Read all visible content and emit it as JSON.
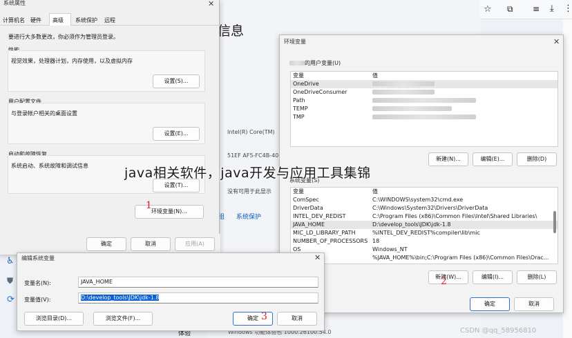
{
  "browser": {
    "tab_text": "",
    "icons": [
      "star-icon",
      "extensions-icon",
      "reading-list-icon",
      "download-icon",
      "more-icon"
    ]
  },
  "background_settings": {
    "heading": "信息",
    "spec_rows": [
      "Intel(R) Core(TM)",
      "51EF AF5-FC4B-40",
      "没有可用于此显示"
    ],
    "links": [
      "组",
      "系统保护"
    ],
    "bottom_label": "体验",
    "bottom_value": "Windows 功能体验包 1000.26100.54.0",
    "side_icons": [
      "accessibility-icon",
      "shield-icon",
      "update-icon"
    ]
  },
  "system_properties": {
    "title": "系统属性",
    "tabs": [
      "计算机名",
      "硬件",
      "高级",
      "系统保护",
      "远程"
    ],
    "active_tab": 2,
    "admin_note": "要进行大多数更改，你必须作为管理员登录。",
    "performance": {
      "title": "性能",
      "desc": "视觉效果，处理器计划，内存使用，以及虚拟内存",
      "button": "设置(S)..."
    },
    "user_profiles": {
      "title": "用户配置文件",
      "desc": "与登录帐户相关的桌面设置",
      "button": "设置(E)..."
    },
    "startup_recovery": {
      "title": "启动和故障恢复",
      "desc": "系统启动、系统故障和调试信息",
      "button": "设置(T)..."
    },
    "env_button": "环境变量(N)...",
    "ok": "确定",
    "cancel": "取消",
    "apply": "应用(A)"
  },
  "env_vars": {
    "title": "环境变量",
    "user_section": "的用户变量(U)",
    "col_var": "变量",
    "col_value": "值",
    "user_vars": [
      {
        "name": "OneDrive",
        "value": "C:\\Users\\...\\OneDrive"
      },
      {
        "name": "OneDriveConsumer",
        "value": "C:\\Users\\...\\OneDrive"
      },
      {
        "name": "Path",
        "value": ""
      },
      {
        "name": "TEMP",
        "value": ""
      },
      {
        "name": "TMP",
        "value": ""
      }
    ],
    "user_buttons": [
      "新建(N)...",
      "编辑(E)...",
      "删除(D)"
    ],
    "system_section": "系统变量(S)",
    "system_vars": [
      {
        "name": "ComSpec",
        "value": "C:\\WINDOWS\\system32\\cmd.exe"
      },
      {
        "name": "DriverData",
        "value": "C:\\Windows\\System32\\Drivers\\DriverData"
      },
      {
        "name": "INTEL_DEV_REDIST",
        "value": "C:\\Program Files (x86)\\Common Files\\Intel\\Shared Libraries\\"
      },
      {
        "name": "JAVA_HOME",
        "value": "D:\\develop_tools\\JDK\\jdk-1.8"
      },
      {
        "name": "MIC_LD_LIBRARY_PATH",
        "value": "%INTEL_DEV_REDIST%compiler\\lib\\mic"
      },
      {
        "name": "NUMBER_OF_PROCESSORS",
        "value": "18"
      },
      {
        "name": "OS",
        "value": "Windows_NT"
      },
      {
        "name": "Path",
        "value": "%JAVA_HOME%\\bin;C:\\Program Files (x86)\\Common Files\\Orac..."
      }
    ],
    "system_buttons": [
      "新建(W)...",
      "编辑(I)...",
      "删除(L)"
    ],
    "ok": "确定",
    "cancel": "取消"
  },
  "edit_dialog": {
    "title": "编辑系统变量",
    "name_label": "变量名(N):",
    "name_value": "JAVA_HOME",
    "value_label": "变量值(V):",
    "value_value": "D:\\develop_tools\\JDK\\jdk-1.8",
    "browse_dir": "浏览目录(D)...",
    "browse_file": "浏览文件(F)...",
    "ok": "确定",
    "cancel": "取消"
  },
  "overlay": {
    "watermark": "java相关软件，java开发与应用工具集锦",
    "marks": [
      "1",
      "2",
      "3"
    ],
    "csdn": "CSDN @qq_58956810"
  }
}
